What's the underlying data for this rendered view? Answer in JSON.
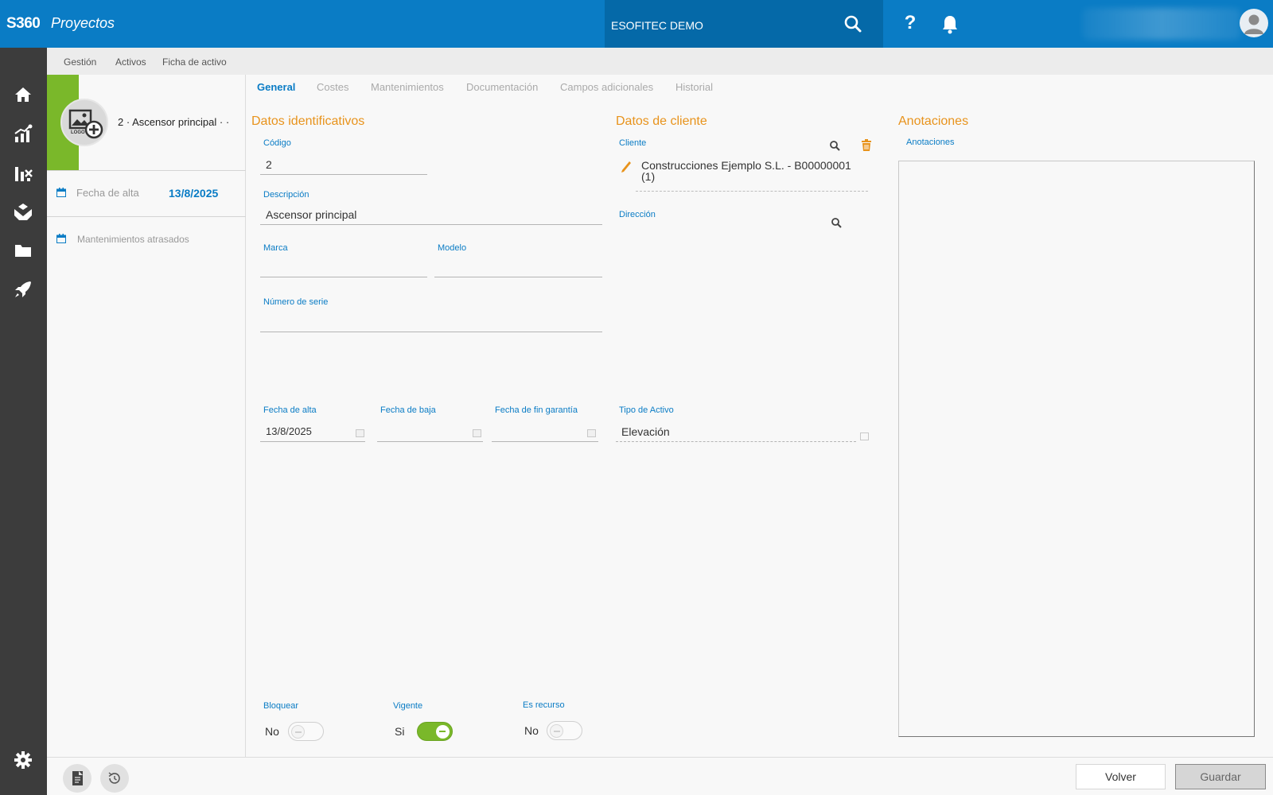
{
  "app": {
    "brand": "S360",
    "module": "Proyectos"
  },
  "topbar": {
    "company": "ESOFITEC DEMO"
  },
  "breadcrumb": [
    "Gestión",
    "Activos",
    "Ficha de activo"
  ],
  "summary": {
    "logo_text": "LOGO",
    "asset_title": "2 · Ascensor principal · ·",
    "fecha_alta_label": "Fecha de alta",
    "fecha_alta_value": "13/8/2025",
    "atrasados_label": "Mantenimientos atrasados"
  },
  "tabs": [
    {
      "label": "General",
      "active": true
    },
    {
      "label": "Costes"
    },
    {
      "label": "Mantenimientos"
    },
    {
      "label": "Documentación"
    },
    {
      "label": "Campos adicionales"
    },
    {
      "label": "Historial"
    }
  ],
  "sections": {
    "identificativos": "Datos identificativos",
    "cliente": "Datos de cliente",
    "anotaciones": "Anotaciones"
  },
  "fields": {
    "codigo": {
      "label": "Código",
      "value": "2"
    },
    "descripcion": {
      "label": "Descripción",
      "value": "Ascensor principal"
    },
    "marca": {
      "label": "Marca",
      "value": ""
    },
    "modelo": {
      "label": "Modelo",
      "value": ""
    },
    "numero_serie": {
      "label": "Número de serie",
      "value": ""
    },
    "fecha_alta": {
      "label": "Fecha de alta",
      "value": "13/8/2025"
    },
    "fecha_baja": {
      "label": "Fecha de baja",
      "value": ""
    },
    "fecha_fin_garantia": {
      "label": "Fecha de fin garantía",
      "value": ""
    },
    "tipo_activo": {
      "label": "Tipo de Activo",
      "value": "Elevación"
    },
    "cliente": {
      "label": "Cliente",
      "value": "Construcciones Ejemplo S.L. - B00000001 (1)"
    },
    "direccion": {
      "label": "Dirección",
      "value": ""
    },
    "anotaciones": {
      "label": "Anotaciones",
      "value": ""
    }
  },
  "toggles": {
    "bloquear": {
      "label": "Bloquear",
      "state_text": "No",
      "on": false
    },
    "vigente": {
      "label": "Vigente",
      "state_text": "Si",
      "on": true
    },
    "es_recurso": {
      "label": "Es recurso",
      "state_text": "No",
      "on": false
    }
  },
  "footer": {
    "volver": "Volver",
    "guardar": "Guardar"
  },
  "colors": {
    "topbar": "#0a7cc5",
    "accent_orange": "#e8931c",
    "green": "#7ab82a",
    "nav_bg": "#3c3c3c"
  },
  "icons": [
    "search-icon",
    "help-icon",
    "bell-icon",
    "user-avatar-icon",
    "home-icon",
    "analytics-icon",
    "tools-chart-icon",
    "hand-care-icon",
    "folder-icon",
    "rocket-icon",
    "settings-icon",
    "calendar-icon",
    "pencil-icon",
    "trash-icon",
    "report-icon",
    "history-icon"
  ]
}
